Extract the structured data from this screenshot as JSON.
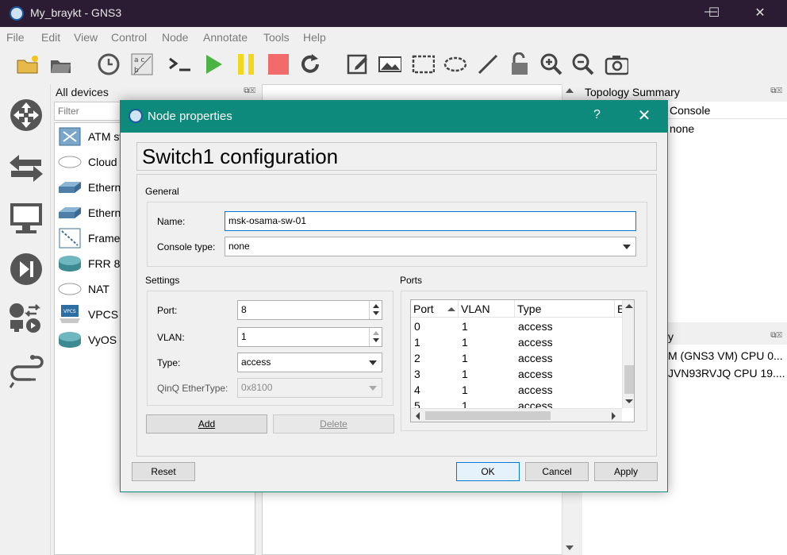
{
  "window": {
    "title": "My_braykt - GNS3"
  },
  "menu": [
    "File",
    "Edit",
    "View",
    "Control",
    "Node",
    "Annotate",
    "Tools",
    "Help"
  ],
  "devices": {
    "title": "All devices",
    "filter_placeholder": "Filter",
    "items": [
      "ATM sw",
      "Cloud",
      "Ethern",
      "Ethern",
      "Frame",
      "FRR 8.",
      "NAT",
      "VPCS",
      "VyOS 1"
    ]
  },
  "topology": {
    "title": "Topology Summary",
    "console_header": "Console",
    "console_value": "none"
  },
  "servers": {
    "title_fragment": "y",
    "rows": [
      "M (GNS3 VM) CPU 0...",
      "JVN93RVJQ CPU 19...."
    ]
  },
  "dialog": {
    "title": "Node properties",
    "help": "?",
    "config_title": "Switch1 configuration",
    "general": {
      "group_label": "General",
      "name_label": "Name:",
      "name_value": "msk-osama-sw-01",
      "console_label": "Console type:",
      "console_value": "none"
    },
    "settings": {
      "group_label": "Settings",
      "port_label": "Port:",
      "port_value": "8",
      "vlan_label": "VLAN:",
      "vlan_value": "1",
      "type_label": "Type:",
      "type_value": "access",
      "qinq_label": "QinQ EtherType:",
      "qinq_value": "0x8100",
      "add": "Add",
      "delete": "Delete"
    },
    "ports": {
      "group_label": "Ports",
      "headers": [
        "Port",
        "VLAN",
        "Type",
        "E"
      ],
      "rows": [
        {
          "port": "0",
          "vlan": "1",
          "type": "access"
        },
        {
          "port": "1",
          "vlan": "1",
          "type": "access"
        },
        {
          "port": "2",
          "vlan": "1",
          "type": "access"
        },
        {
          "port": "3",
          "vlan": "1",
          "type": "access"
        },
        {
          "port": "4",
          "vlan": "1",
          "type": "access"
        },
        {
          "port": "5",
          "vlan": "1",
          "type": "access"
        }
      ]
    },
    "buttons": {
      "reset": "Reset",
      "ok": "OK",
      "cancel": "Cancel",
      "apply": "Apply"
    }
  },
  "colors": {
    "titlebar": "#2b1b33",
    "dialog_accent": "#0e8a7c",
    "focus": "#0078d7"
  }
}
